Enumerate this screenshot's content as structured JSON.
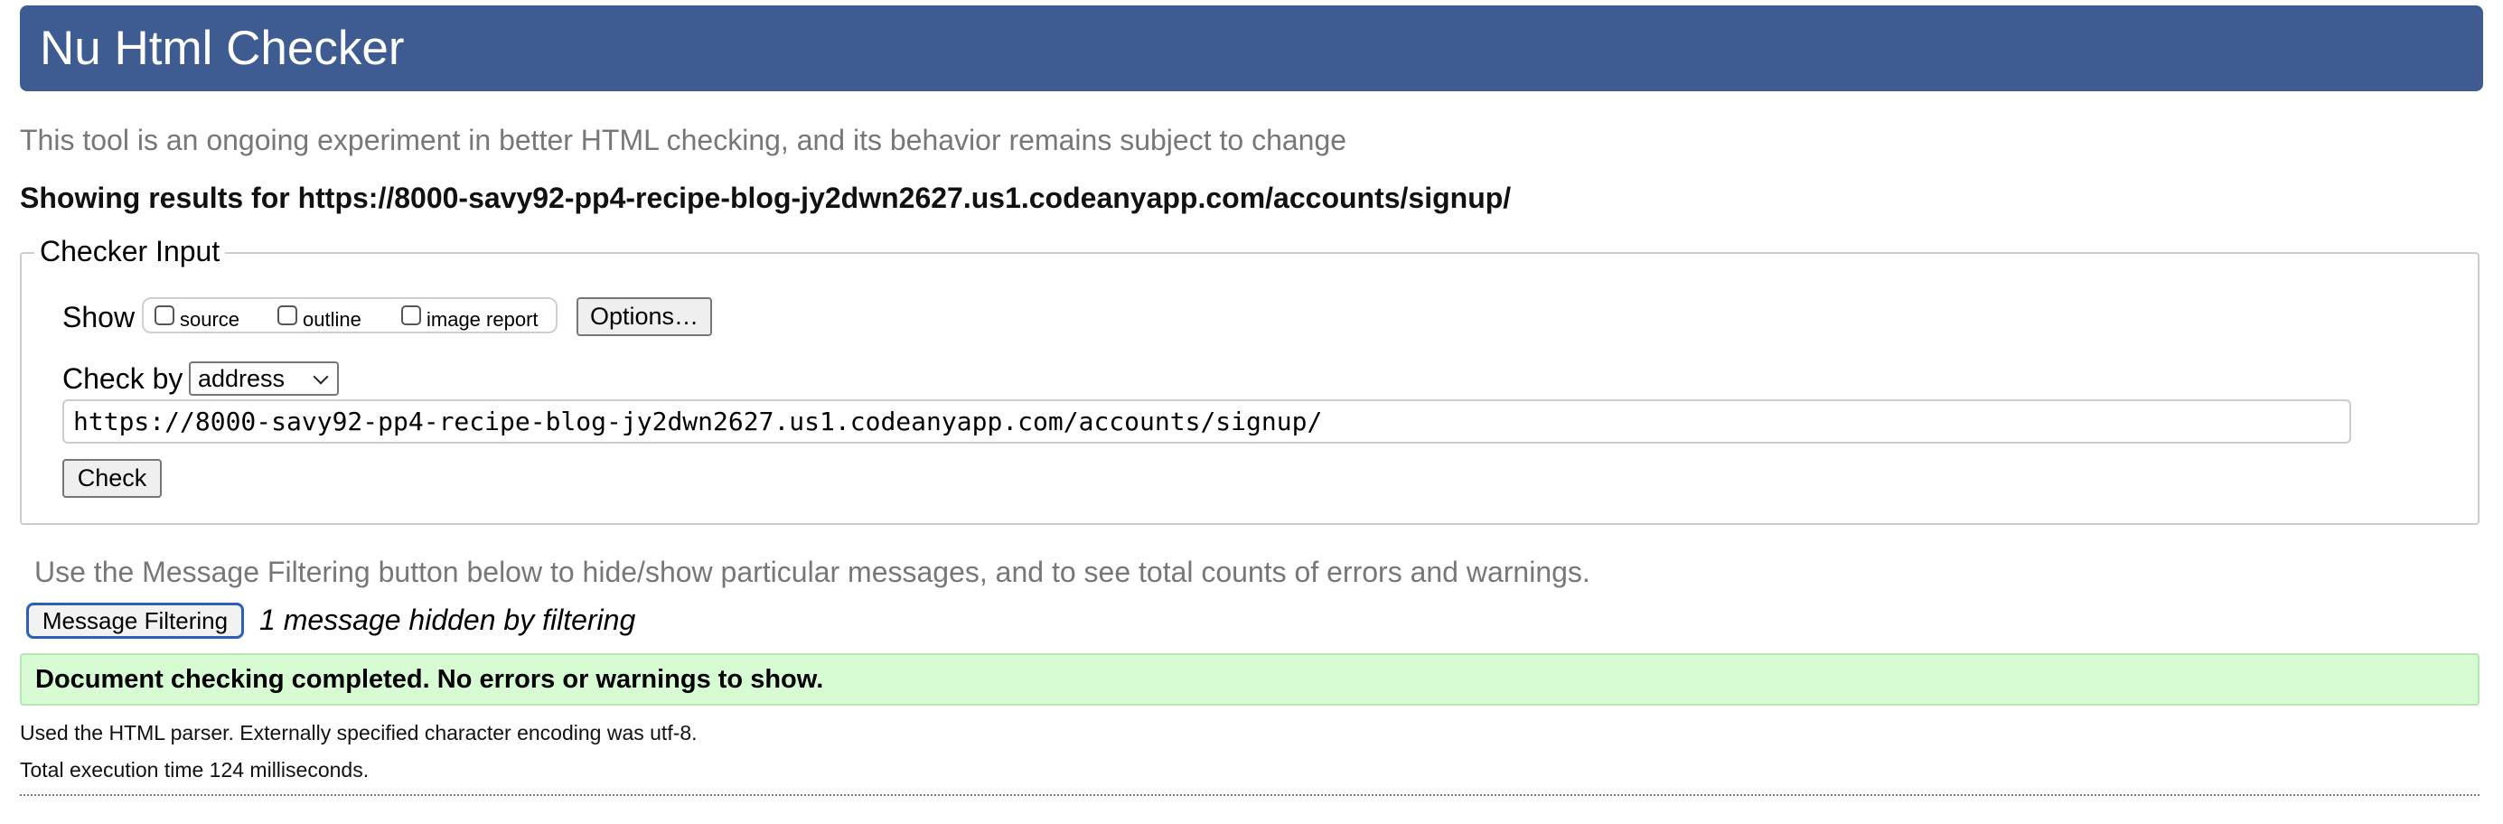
{
  "header": {
    "title": "Nu Html Checker"
  },
  "subtitle": "This tool is an ongoing experiment in better HTML checking, and its behavior remains subject to change",
  "results_heading": "Showing results for https://8000-savy92-pp4-recipe-blog-jy2dwn2627.us1.codeanyapp.com/accounts/signup/",
  "checker_input": {
    "legend": "Checker Input",
    "show_label": "Show",
    "show_options": [
      {
        "label": "source",
        "checked": false
      },
      {
        "label": "outline",
        "checked": false
      },
      {
        "label": "image report",
        "checked": false
      }
    ],
    "options_button": "Options…",
    "check_by_label": "Check by",
    "check_by_selected": "address",
    "url_value": "https://8000-savy92-pp4-recipe-blog-jy2dwn2627.us1.codeanyapp.com/accounts/signup/",
    "check_button": "Check"
  },
  "filtering": {
    "note": "Use the Message Filtering button below to hide/show particular messages, and to see total counts of errors and warnings.",
    "button": "Message Filtering",
    "hidden_note": "1 message hidden by filtering"
  },
  "result": {
    "message": "Document checking completed. No errors or warnings to show."
  },
  "info": {
    "parser": "Used the HTML parser. Externally specified character encoding was utf-8.",
    "time": "Total execution time 124 milliseconds."
  },
  "colors": {
    "header_bg": "#3e5c92",
    "success_bg": "#d7fcd4",
    "filter_button_border": "#2b5fb8"
  }
}
